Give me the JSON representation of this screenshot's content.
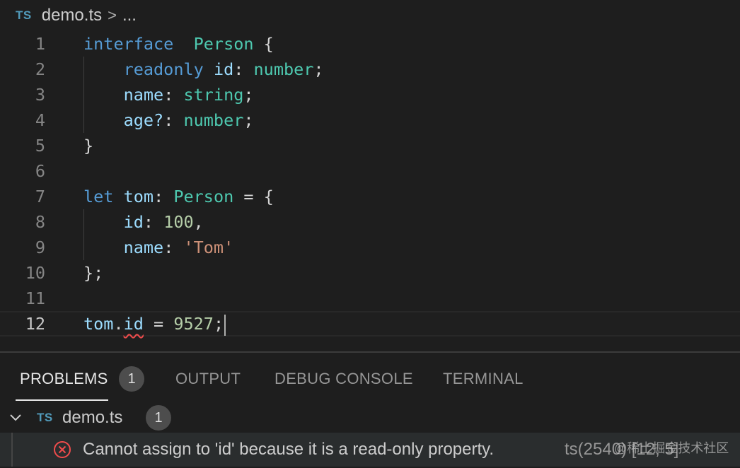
{
  "breadcrumb": {
    "lang_badge": "TS",
    "file": "demo.ts",
    "separator": ">",
    "more": "..."
  },
  "editor": {
    "lines": [
      {
        "n": "1",
        "tokens": [
          [
            "kw",
            "interface"
          ],
          [
            "",
            "  "
          ],
          [
            "ty",
            "Person"
          ],
          [
            "",
            " {"
          ]
        ]
      },
      {
        "n": "2",
        "tokens": [
          [
            "",
            "    "
          ],
          [
            "kw",
            "readonly"
          ],
          [
            "",
            " "
          ],
          [
            "pr",
            "id"
          ],
          [
            "",
            ": "
          ],
          [
            "ty",
            "number"
          ],
          [
            "",
            ";"
          ]
        ]
      },
      {
        "n": "3",
        "tokens": [
          [
            "",
            "    "
          ],
          [
            "pr",
            "name"
          ],
          [
            "",
            ": "
          ],
          [
            "ty",
            "string"
          ],
          [
            "",
            ";"
          ]
        ]
      },
      {
        "n": "4",
        "tokens": [
          [
            "",
            "    "
          ],
          [
            "pr",
            "age?"
          ],
          [
            "",
            ": "
          ],
          [
            "ty",
            "number"
          ],
          [
            "",
            ";"
          ]
        ]
      },
      {
        "n": "5",
        "tokens": [
          [
            "",
            "}"
          ]
        ]
      },
      {
        "n": "6",
        "tokens": []
      },
      {
        "n": "7",
        "tokens": [
          [
            "kw",
            "let"
          ],
          [
            "",
            " "
          ],
          [
            "pr",
            "tom"
          ],
          [
            "",
            ": "
          ],
          [
            "ty",
            "Person"
          ],
          [
            "",
            " = {"
          ]
        ]
      },
      {
        "n": "8",
        "tokens": [
          [
            "",
            "    "
          ],
          [
            "pr",
            "id"
          ],
          [
            "",
            ": "
          ],
          [
            "num",
            "100"
          ],
          [
            "",
            ","
          ]
        ]
      },
      {
        "n": "9",
        "tokens": [
          [
            "",
            "    "
          ],
          [
            "pr",
            "name"
          ],
          [
            "",
            ": "
          ],
          [
            "str",
            "'Tom'"
          ]
        ]
      },
      {
        "n": "10",
        "tokens": [
          [
            "",
            "};"
          ]
        ]
      },
      {
        "n": "11",
        "tokens": []
      },
      {
        "n": "12",
        "tokens": [
          [
            "pr",
            "tom"
          ],
          [
            "",
            "."
          ],
          [
            "pr squig",
            "id"
          ],
          [
            "",
            " = "
          ],
          [
            "num",
            "9527"
          ],
          [
            "",
            ";"
          ]
        ]
      }
    ],
    "current_line": "12"
  },
  "panel": {
    "tabs": [
      "PROBLEMS",
      "OUTPUT",
      "DEBUG CONSOLE",
      "TERMINAL"
    ],
    "problems_count": "1",
    "file_badge": "TS",
    "file_name": "demo.ts",
    "file_count": "1",
    "error_message": "Cannot assign to 'id' because it is a read-only property.",
    "error_code": "ts(2540)  [12, 5]"
  },
  "watermark": "@稀土掘金技术社区",
  "colors": {
    "keyword": "#569cd6",
    "type": "#4ec9b0",
    "property": "#9cdcfe",
    "number": "#b5cea8",
    "string": "#ce9178",
    "error": "#f14c4c"
  }
}
